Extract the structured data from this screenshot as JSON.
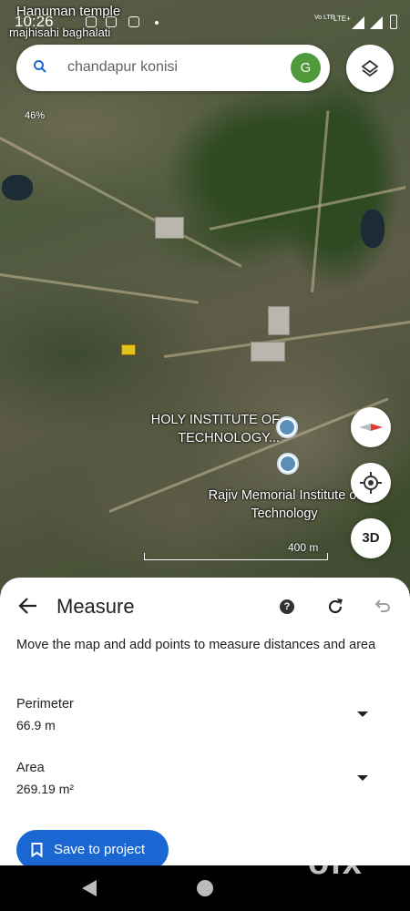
{
  "status_bar": {
    "time": "10:26",
    "network_label": "Vo LTE",
    "lte_label": "LTE+"
  },
  "map": {
    "overlay_text_1": "Hanuman temple",
    "overlay_text_2": "majhisahi baghalati",
    "zoom_percent": "46%",
    "poi_1_name": "HOLY INSTITUTE OF TECHNOLOGY...",
    "poi_2_name": "Rajiv Memorial Institute of Technology",
    "scale_label": "400 m",
    "button_3d_label": "3D",
    "watermark": "olx"
  },
  "search": {
    "query": "chandapur konisi",
    "avatar_letter": "G"
  },
  "measure": {
    "title": "Measure",
    "help_label": "?",
    "description": "Move the map and add points to measure distances and area",
    "perimeter_label": "Perimeter",
    "perimeter_value": "66.9 m",
    "area_label": "Area",
    "area_value": "269.19 m²",
    "save_button_label": "Save to project"
  },
  "colors": {
    "accent": "#1a66d2",
    "avatar": "#4f9a3a"
  },
  "icons": [
    "search-icon",
    "layers-icon",
    "compass-icon",
    "my-location-icon",
    "school-icon",
    "back-arrow-icon",
    "help-icon",
    "refresh-icon",
    "undo-icon",
    "bookmark-icon"
  ]
}
